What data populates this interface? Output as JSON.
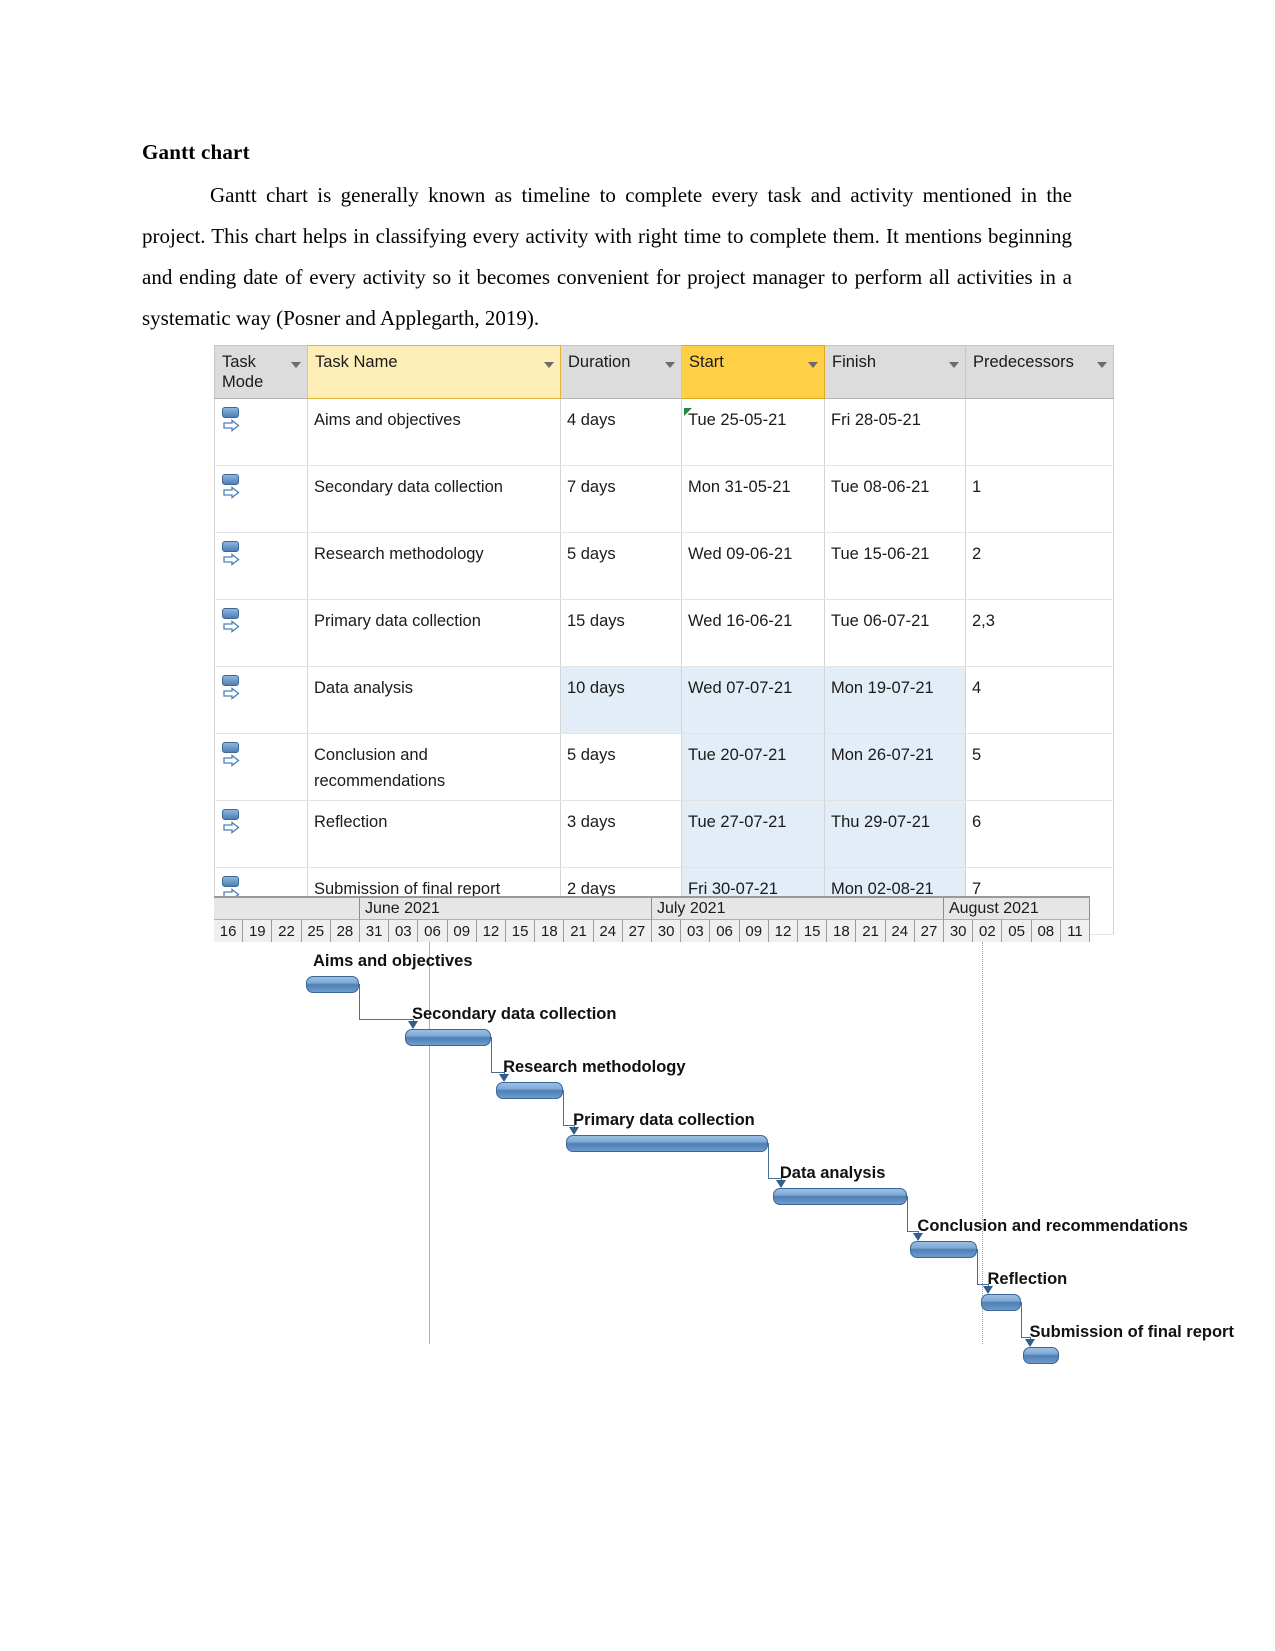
{
  "document": {
    "heading": "Gantt chart",
    "paragraph": "Gantt chart is generally known as timeline to complete every task and activity mentioned in the project. This chart helps in classifying every activity with right time to complete them. It mentions beginning and ending date of every activity so it becomes convenient for project manager to perform all activities in a systematic way (Posner and Applegarth, 2019)."
  },
  "table": {
    "columns": [
      {
        "label": "Task Mode",
        "highlight": "none"
      },
      {
        "label": "Task Name",
        "highlight": "light"
      },
      {
        "label": "Duration",
        "highlight": "none"
      },
      {
        "label": "Start",
        "highlight": "strong"
      },
      {
        "label": "Finish",
        "highlight": "none"
      },
      {
        "label": "Predecessors",
        "highlight": "none"
      }
    ],
    "rows": [
      {
        "mode": "auto-scheduled",
        "name": "Aims and objectives",
        "duration": "4 days",
        "start": "Tue 25-05-21",
        "finish": "Fri 28-05-21",
        "predecessors": ""
      },
      {
        "mode": "auto-scheduled",
        "name": "Secondary data collection",
        "duration": "7 days",
        "start": "Mon 31-05-21",
        "finish": "Tue 08-06-21",
        "predecessors": "1"
      },
      {
        "mode": "auto-scheduled",
        "name": "Research methodology",
        "duration": "5 days",
        "start": "Wed 09-06-21",
        "finish": "Tue 15-06-21",
        "predecessors": "2"
      },
      {
        "mode": "auto-scheduled",
        "name": "Primary data collection",
        "duration": "15 days",
        "start": "Wed 16-06-21",
        "finish": "Tue 06-07-21",
        "predecessors": "2,3"
      },
      {
        "mode": "auto-scheduled",
        "name": "Data analysis",
        "duration": "10 days",
        "start": "Wed 07-07-21",
        "finish": "Mon 19-07-21",
        "predecessors": "4"
      },
      {
        "mode": "auto-scheduled",
        "name": "Conclusion and recommendations",
        "duration": "5 days",
        "start": "Tue 20-07-21",
        "finish": "Mon 26-07-21",
        "predecessors": "5"
      },
      {
        "mode": "auto-scheduled",
        "name": "Reflection",
        "duration": "3 days",
        "start": "Tue 27-07-21",
        "finish": "Thu 29-07-21",
        "predecessors": "6"
      },
      {
        "mode": "auto-scheduled",
        "name": "Submission of final report",
        "duration": "2 days",
        "start": "Fri 30-07-21",
        "finish": "Mon 02-08-21",
        "predecessors": "7"
      }
    ]
  },
  "chart_data": {
    "type": "bar",
    "title": "Gantt chart",
    "xlabel": "",
    "ylabel": "",
    "months": [
      {
        "label": "",
        "span": 5
      },
      {
        "label": "June 2021",
        "span": 10
      },
      {
        "label": "July 2021",
        "span": 10
      },
      {
        "label": "August 2021",
        "span": 5
      }
    ],
    "day_ticks": [
      "16",
      "19",
      "22",
      "25",
      "28",
      "31",
      "03",
      "06",
      "09",
      "12",
      "15",
      "18",
      "21",
      "24",
      "27",
      "30",
      "03",
      "06",
      "09",
      "12",
      "15",
      "18",
      "21",
      "24",
      "27",
      "30",
      "02",
      "05",
      "08",
      "11"
    ],
    "categories": [
      "Aims and objectives",
      "Secondary data collection",
      "Research methodology",
      "Primary data collection",
      "Data analysis",
      "Conclusion and recommendations",
      "Reflection",
      "Submission of final report"
    ],
    "values": [
      4,
      7,
      5,
      15,
      10,
      5,
      3,
      2
    ],
    "bars": [
      {
        "task": "Aims and objectives",
        "start": "Tue 25-05-21",
        "finish": "Fri 28-05-21",
        "duration_days": 4,
        "left_pct": 10.5,
        "width_pct": 6.0
      },
      {
        "task": "Secondary data collection",
        "start": "Mon 31-05-21",
        "finish": "Tue 08-06-21",
        "duration_days": 7,
        "left_pct": 21.8,
        "width_pct": 9.8
      },
      {
        "task": "Research methodology",
        "start": "Wed 09-06-21",
        "finish": "Tue 15-06-21",
        "duration_days": 5,
        "left_pct": 32.2,
        "width_pct": 7.6
      },
      {
        "task": "Primary data collection",
        "start": "Wed 16-06-21",
        "finish": "Tue 06-07-21",
        "duration_days": 15,
        "left_pct": 40.2,
        "width_pct": 23.0
      },
      {
        "task": "Data analysis",
        "start": "Wed 07-07-21",
        "finish": "Mon 19-07-21",
        "duration_days": 10,
        "left_pct": 63.8,
        "width_pct": 15.3
      },
      {
        "task": "Conclusion and recommendations",
        "start": "Tue 20-07-21",
        "finish": "Mon 26-07-21",
        "duration_days": 5,
        "left_pct": 79.5,
        "width_pct": 7.6
      },
      {
        "task": "Reflection",
        "start": "Tue 27-07-21",
        "finish": "Thu 29-07-21",
        "duration_days": 3,
        "left_pct": 87.5,
        "width_pct": 4.6
      },
      {
        "task": "Submission of final report",
        "start": "Fri 30-07-21",
        "finish": "Mon 02-08-21",
        "duration_days": 2,
        "left_pct": 92.3,
        "width_pct": 4.2
      }
    ],
    "today_line_pct": 24.6,
    "status_line_pct": 87.7,
    "legend": [],
    "grid": true,
    "accent_color": "#5b8dc2",
    "today_color": "#e5a252"
  }
}
